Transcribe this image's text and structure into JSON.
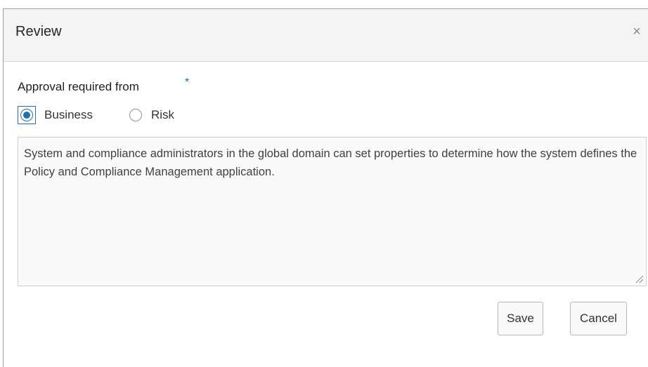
{
  "dialog": {
    "title": "Review",
    "close_icon": "close-icon",
    "close_glyph": "×"
  },
  "approval": {
    "label": "Approval required from",
    "required_marker": "*",
    "options": [
      {
        "label": "Business",
        "selected": true
      },
      {
        "label": "Risk",
        "selected": false
      }
    ]
  },
  "comment": {
    "value": "System and compliance administrators in the global domain can set properties to determine how the system defines the Policy and Compliance Management application."
  },
  "actions": {
    "save_label": "Save",
    "cancel_label": "Cancel"
  },
  "colors": {
    "accent": "#1f6db3",
    "header_bg": "#f4f4f4"
  }
}
